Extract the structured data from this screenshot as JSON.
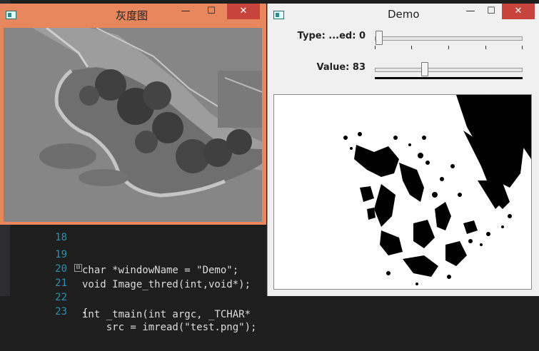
{
  "editor": {
    "lines": [
      {
        "num": "18",
        "text": ""
      },
      {
        "num": "19",
        "text": "char *windowName = \"Demo\";"
      },
      {
        "num": "20",
        "text": "void Image_thred(int,void*);"
      },
      {
        "num": "21",
        "text": "int _tmain(int argc, _TCHAR*"
      },
      {
        "num": "22",
        "text": "{"
      },
      {
        "num": "23",
        "text": "    src = imread(\"test.png\");"
      }
    ],
    "fold_symbol": "⊟"
  },
  "gray_window": {
    "title": "灰度图",
    "controls": {
      "minimize": "—",
      "maximize": "☐",
      "close": "✕"
    }
  },
  "demo_window": {
    "title": "Demo",
    "controls": {
      "minimize": "—",
      "maximize": "☐",
      "close": "✕"
    },
    "trackbars": [
      {
        "label": "Type: ...ed: 0",
        "value_fraction": 0.0
      },
      {
        "label": "Value: 83",
        "value_fraction": 0.33
      }
    ]
  },
  "colors": {
    "gray_window_frame": "#e8875e",
    "close_button": "#c7443c",
    "editor_bg": "#1e1e1e",
    "line_number": "#2b91af",
    "keyword": "#569cd6",
    "string": "#d69d85"
  },
  "icons": [
    "window-app-icon",
    "minimize-icon",
    "maximize-icon",
    "close-icon",
    "fold-icon"
  ]
}
